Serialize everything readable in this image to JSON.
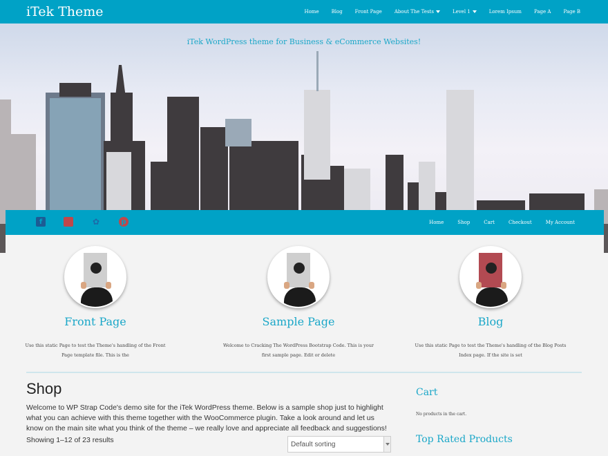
{
  "header": {
    "site_title": "iTek Theme",
    "nav": [
      {
        "label": "Home"
      },
      {
        "label": "Blog"
      },
      {
        "label": "Front Page"
      },
      {
        "label": "About The Tests",
        "dropdown": true
      },
      {
        "label": "Level 1",
        "dropdown": true
      },
      {
        "label": "Lorem Ipsum"
      },
      {
        "label": "Page A"
      },
      {
        "label": "Page B"
      }
    ]
  },
  "hero": {
    "tagline": "iTek WordPress theme for Business & eCommerce Websites!"
  },
  "secondary_bar": {
    "social": [
      "facebook-icon",
      "google-plus-icon",
      "twitter-icon",
      "pinterest-icon"
    ],
    "nav": [
      {
        "label": "Home"
      },
      {
        "label": "Shop"
      },
      {
        "label": "Cart"
      },
      {
        "label": "Checkout"
      },
      {
        "label": "My Account"
      }
    ]
  },
  "features": [
    {
      "title": "Front Page",
      "text": "Use this static Page to test the Theme's handling of the Front Page template file. This is the"
    },
    {
      "title": "Sample Page",
      "text": "Welcome to Cracking The WordPress Bootstrap Code. This is your first sample page. Edit or delete"
    },
    {
      "title": "Blog",
      "text": "Use this static Page to test the Theme's handling of the Blog Posts Index page. If the site is set"
    }
  ],
  "shop": {
    "title": "Shop",
    "description": "Welcome to WP Strap Code's demo site for the iTek WordPress theme. Below is a sample shop just to highlight what you can achieve with this theme together with the WooCommerce plugin. Take a look around and let us know on the main site what you think of the theme – we really love and appreciate all feedback and suggestions!",
    "showing": "Showing 1–12 of 23 results",
    "sort_value": "Default sorting"
  },
  "sidebar": {
    "cart_title": "Cart",
    "cart_text": "No products in the cart.",
    "top_rated_title": "Top Rated Products"
  },
  "colors": {
    "accent": "#00a2c6",
    "heading": "#1aa7c8"
  }
}
